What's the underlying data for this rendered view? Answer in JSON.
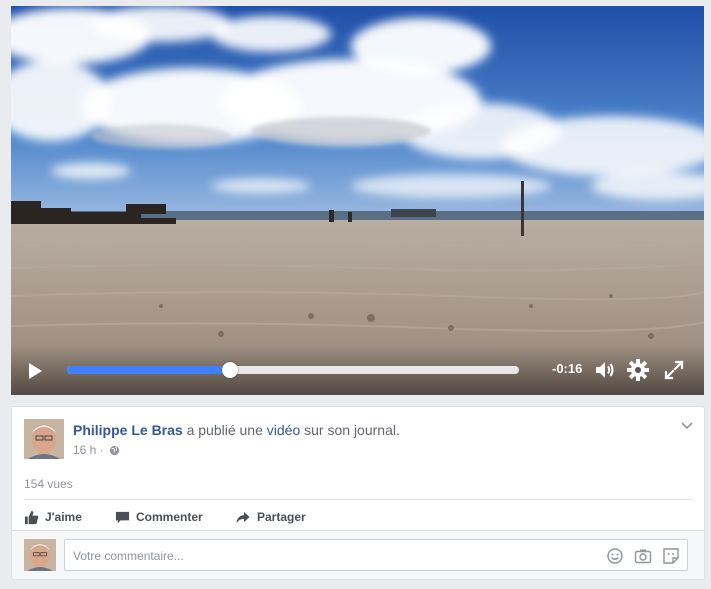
{
  "video": {
    "time_remaining": "-0:16",
    "progress": 0.36,
    "icons": {
      "play": "play-icon",
      "volume": "volume-icon",
      "settings": "gear-icon",
      "fullscreen": "fullscreen-icon"
    }
  },
  "post": {
    "author": "Philippe Le Bras",
    "action_prefix": " a publié une ",
    "action_link": "vidéo",
    "action_suffix": " sur son journal.",
    "time": "16 h",
    "separator": " · ",
    "views": "154 vues"
  },
  "actions": {
    "like": "J'aime",
    "comment": "Commenter",
    "share": "Partager"
  },
  "comment": {
    "placeholder": "Votre commentaire..."
  },
  "colors": {
    "link": "#365899",
    "progress": "#4080ff",
    "background": "#e9ebee"
  }
}
